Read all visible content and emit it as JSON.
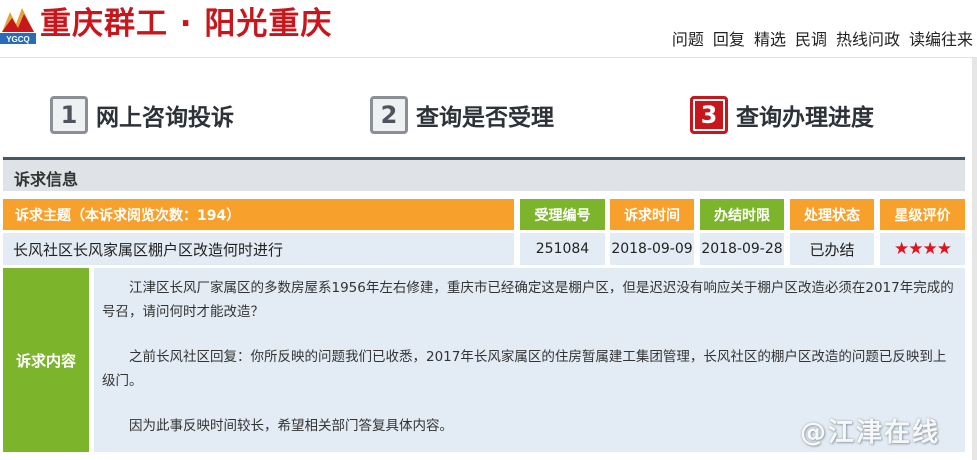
{
  "header": {
    "logo_text": "YGCQ",
    "site_title": "重庆群工 · 阳光重庆",
    "nav": [
      "问题",
      "回复",
      "精选",
      "民调",
      "热线问政",
      "读编往来"
    ]
  },
  "steps": [
    {
      "num": "1",
      "label": "网上咨询投诉",
      "active": false
    },
    {
      "num": "2",
      "label": "查询是否受理",
      "active": false
    },
    {
      "num": "3",
      "label": "查询办理进度",
      "active": true
    }
  ],
  "panel": {
    "title": "诉求信息",
    "headers": {
      "subject": "诉求主题（本诉求阅览次数：194）",
      "number": "受理编号",
      "time": "诉求时间",
      "deadline": "办结时限",
      "status": "处理状态",
      "rating": "星级评价"
    },
    "record": {
      "subject": "长风社区长风家属区棚户区改造何时进行",
      "number": "251084",
      "time": "2018-09-09",
      "deadline": "2018-09-28",
      "status": "已办结",
      "rating": "★★★★"
    },
    "content_label": "诉求内容",
    "content": [
      "江津区长风厂家属区的多数房屋系1956年左右修建，重庆市已经确定这是棚户区，但是迟迟没有响应关于棚户区改造必须在2017年完成的号召，请问何时才能改造？",
      "之前长风社区回复：你所反映的问题我们已收悉，2017年长风家属区的住房暂属建工集团管理，长风社区的棚户区改造的问题已反映到上级门。",
      "因为此事反映时间较长，希望相关部门答复具体内容。"
    ]
  },
  "watermark": "@江津在线",
  "colors": {
    "brand_red": "#c8161d",
    "orange": "#f7a12c",
    "green": "#7cb52b",
    "row_bg": "#e3ecf5"
  }
}
